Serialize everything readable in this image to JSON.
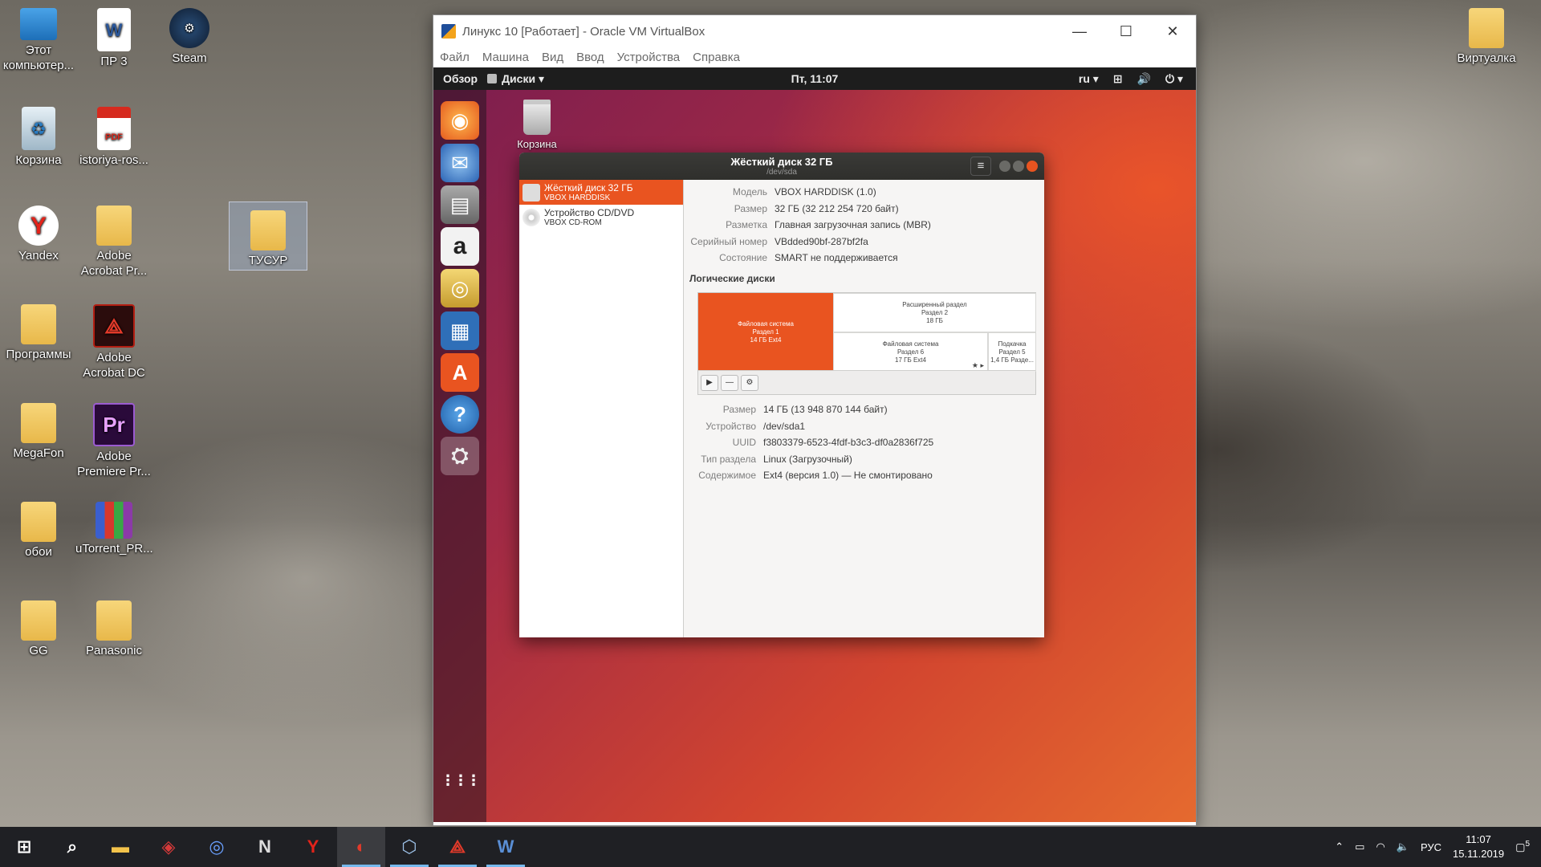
{
  "desktop": {
    "icons": [
      {
        "label": "Этот компьютер...",
        "icon": "computer-icon"
      },
      {
        "label": "ПР 3",
        "icon": "word-doc-icon"
      },
      {
        "label": "Steam",
        "icon": "steam-icon"
      },
      {
        "label": "Корзина",
        "icon": "recycle-bin-icon"
      },
      {
        "label": "istoriya-ros...",
        "icon": "pdf-icon",
        "badge": "PDF"
      },
      {
        "label": "Yandex",
        "icon": "yandex-icon"
      },
      {
        "label": "Adobe Acrobat Pr...",
        "icon": "folder-icon"
      },
      {
        "label": "ТУСУР",
        "icon": "folder-icon"
      },
      {
        "label": "Программы",
        "icon": "folder-icon"
      },
      {
        "label": "Adobe Acrobat DC",
        "icon": "acrobat-icon"
      },
      {
        "label": "MegaFon",
        "icon": "folder-icon"
      },
      {
        "label": "Adobe Premiere Pr...",
        "icon": "premiere-icon",
        "badge": "Pr"
      },
      {
        "label": "обои",
        "icon": "folder-icon"
      },
      {
        "label": "uTorrent_PR...",
        "icon": "winrar-icon"
      },
      {
        "label": "GG",
        "icon": "folder-icon"
      },
      {
        "label": "Panasonic",
        "icon": "folder-icon"
      },
      {
        "label": "Виртуалка",
        "icon": "folder-icon"
      }
    ]
  },
  "vbox": {
    "title": "Линукс 10 [Работает] - Oracle VM VirtualBox",
    "menu": [
      "Файл",
      "Машина",
      "Вид",
      "Ввод",
      "Устройства",
      "Справка"
    ],
    "controls": [
      "—",
      "☐",
      "✕"
    ]
  },
  "ubuntu": {
    "topbar": {
      "overview": "Обзор",
      "app": "Диски ▾",
      "clock": "Пт, 11:07",
      "lang": "ru ▾"
    },
    "trash_label": "Корзина",
    "dock": [
      {
        "icon": "firefox-icon",
        "glyph": "◉"
      },
      {
        "icon": "thunderbird-icon",
        "glyph": "✉"
      },
      {
        "icon": "files-icon",
        "glyph": "▤"
      },
      {
        "icon": "amazon-icon",
        "glyph": "a"
      },
      {
        "icon": "rhythmbox-icon",
        "glyph": "◎"
      },
      {
        "icon": "libreoffice-writer-icon",
        "glyph": "▦"
      },
      {
        "icon": "software-center-icon",
        "glyph": "A"
      },
      {
        "icon": "help-icon",
        "glyph": "?"
      },
      {
        "icon": "disks-icon",
        "glyph": "⛭"
      }
    ],
    "apps_grid_glyph": "⋮⋮⋮"
  },
  "disks": {
    "title": "Жёсткий диск 32 ГБ",
    "subtitle": "/dev/sda",
    "menu_glyph": "≡",
    "devices": [
      {
        "name": "Жёсткий диск 32 ГБ",
        "sub": "VBOX HARDDISK",
        "selected": true
      },
      {
        "name": "Устройство CD/DVD",
        "sub": "VBOX CD-ROM",
        "selected": false
      }
    ],
    "drive": [
      {
        "k": "Модель",
        "v": "VBOX HARDDISK (1.0)"
      },
      {
        "k": "Размер",
        "v": "32 ГБ (32 212 254 720 байт)"
      },
      {
        "k": "Разметка",
        "v": "Главная загрузочная запись (MBR)"
      },
      {
        "k": "Серийный номер",
        "v": "VBdded90bf-287bf2fa"
      },
      {
        "k": "Состояние",
        "v": "SMART не поддерживается"
      }
    ],
    "section": "Логические диски",
    "segments": [
      {
        "l1": "Файловая система",
        "l2": "Раздел 1",
        "l3": "14 ГБ Ext4"
      },
      {
        "l1": "Расширенный раздел",
        "l2": "Раздел 2",
        "l3": "18 ГБ"
      },
      {
        "l1": "Файловая система",
        "l2": "Раздел 6",
        "l3": "17 ГБ Ext4"
      },
      {
        "l1": "Подкачка",
        "l2": "Раздел 5",
        "l3": "1,4 ГБ Разде..."
      }
    ],
    "tools": [
      "▶",
      "—",
      "⚙"
    ],
    "volume": [
      {
        "k": "Размер",
        "v": "14 ГБ (13 948 870 144 байт)"
      },
      {
        "k": "Устройство",
        "v": "/dev/sda1"
      },
      {
        "k": "UUID",
        "v": "f3803379-6523-4fdf-b3c3-df0a2836f725"
      },
      {
        "k": "Тип раздела",
        "v": "Linux (Загрузочный)"
      },
      {
        "k": "Содержимое",
        "v": "Ext4 (версия 1.0) — Не смонтировано"
      }
    ]
  },
  "taskbar": {
    "lang": "РУС",
    "time": "11:07",
    "date": "15.11.2019",
    "notifications": "5"
  }
}
